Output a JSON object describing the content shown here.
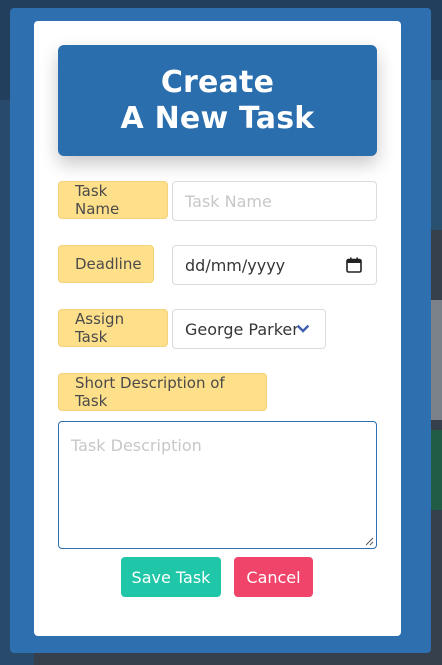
{
  "modal": {
    "title_line1": "Create",
    "title_line2": "A New Task"
  },
  "form": {
    "task_name": {
      "label": "Task Name",
      "placeholder": "Task Name",
      "value": ""
    },
    "deadline": {
      "label": "Deadline",
      "placeholder": "dd/mm/yyyy",
      "icon": "calendar-icon"
    },
    "assign": {
      "label": "Assign Task",
      "selected": "George Parker",
      "icon": "chevron-down-icon"
    },
    "description": {
      "label": "Short Description of Task",
      "placeholder": "Task Description",
      "value": ""
    }
  },
  "buttons": {
    "save": "Save Task",
    "cancel": "Cancel"
  },
  "colors": {
    "frame": "#2e6fb0",
    "header": "#2a6ead",
    "tag": "#ffe08a",
    "save": "#1fc7a8",
    "cancel": "#f0446a",
    "chevron": "#3f5fb0"
  }
}
